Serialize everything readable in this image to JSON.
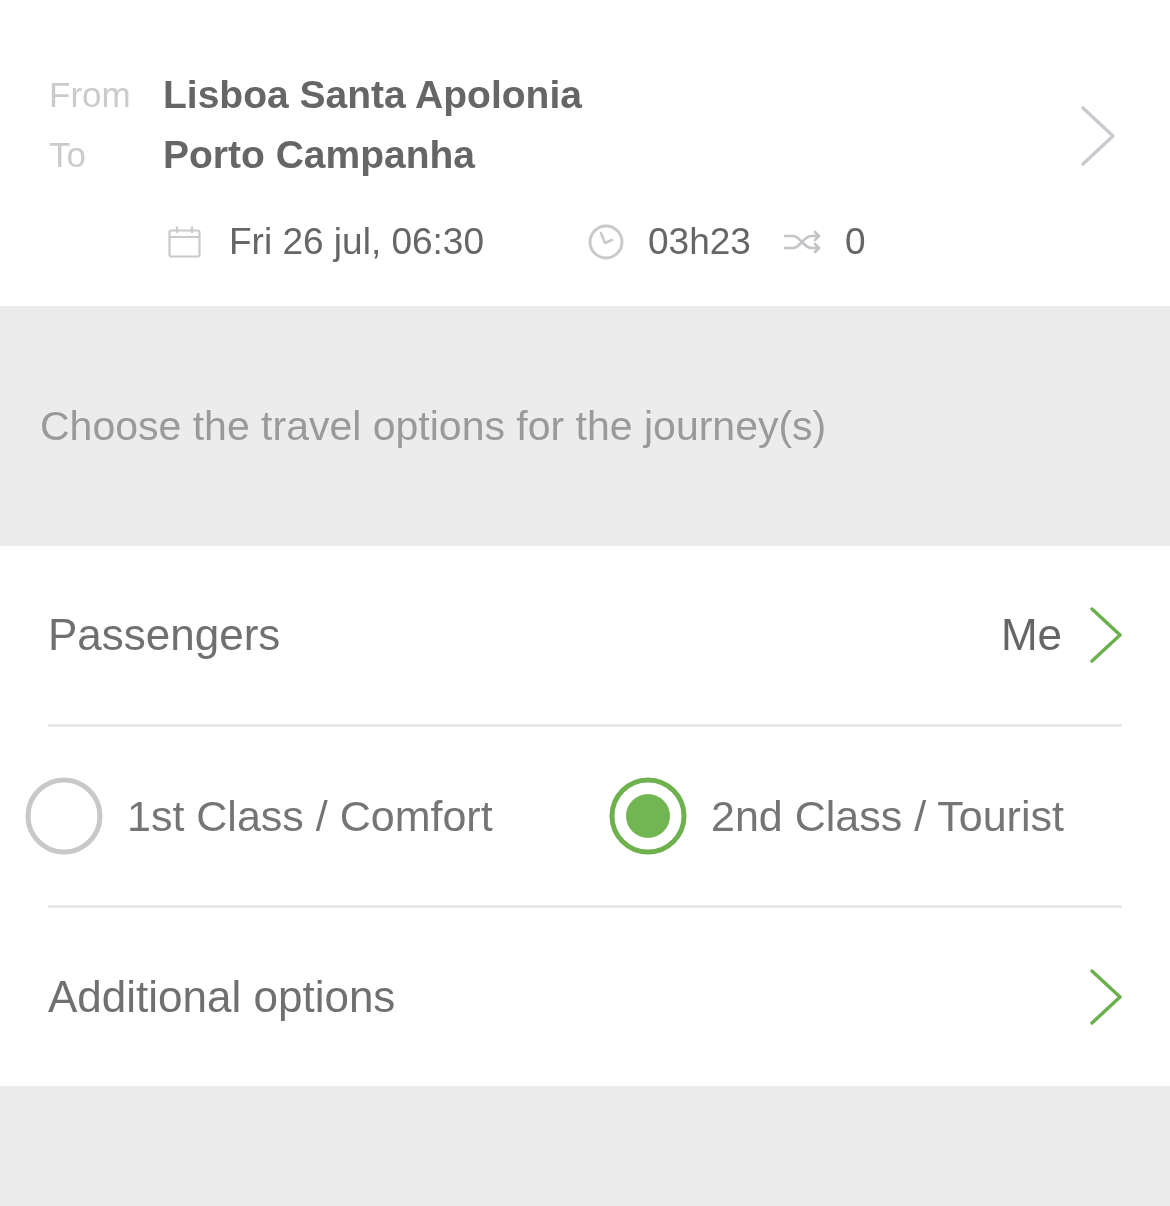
{
  "route": {
    "from_label": "From",
    "from": "Lisboa Santa Apolonia",
    "to_label": "To",
    "to": "Porto Campanha",
    "date": "Fri 26 jul, 06:30",
    "duration": "03h23",
    "changes": "0"
  },
  "notice": "Choose the travel options for the journey(s)",
  "passengers": {
    "label": "Passengers",
    "value": "Me"
  },
  "travel_class": [
    {
      "label": "1st Class / Comfort",
      "selected": false
    },
    {
      "label": "2nd Class / Tourist",
      "selected": true
    }
  ],
  "additional_options": {
    "label": "Additional options"
  }
}
